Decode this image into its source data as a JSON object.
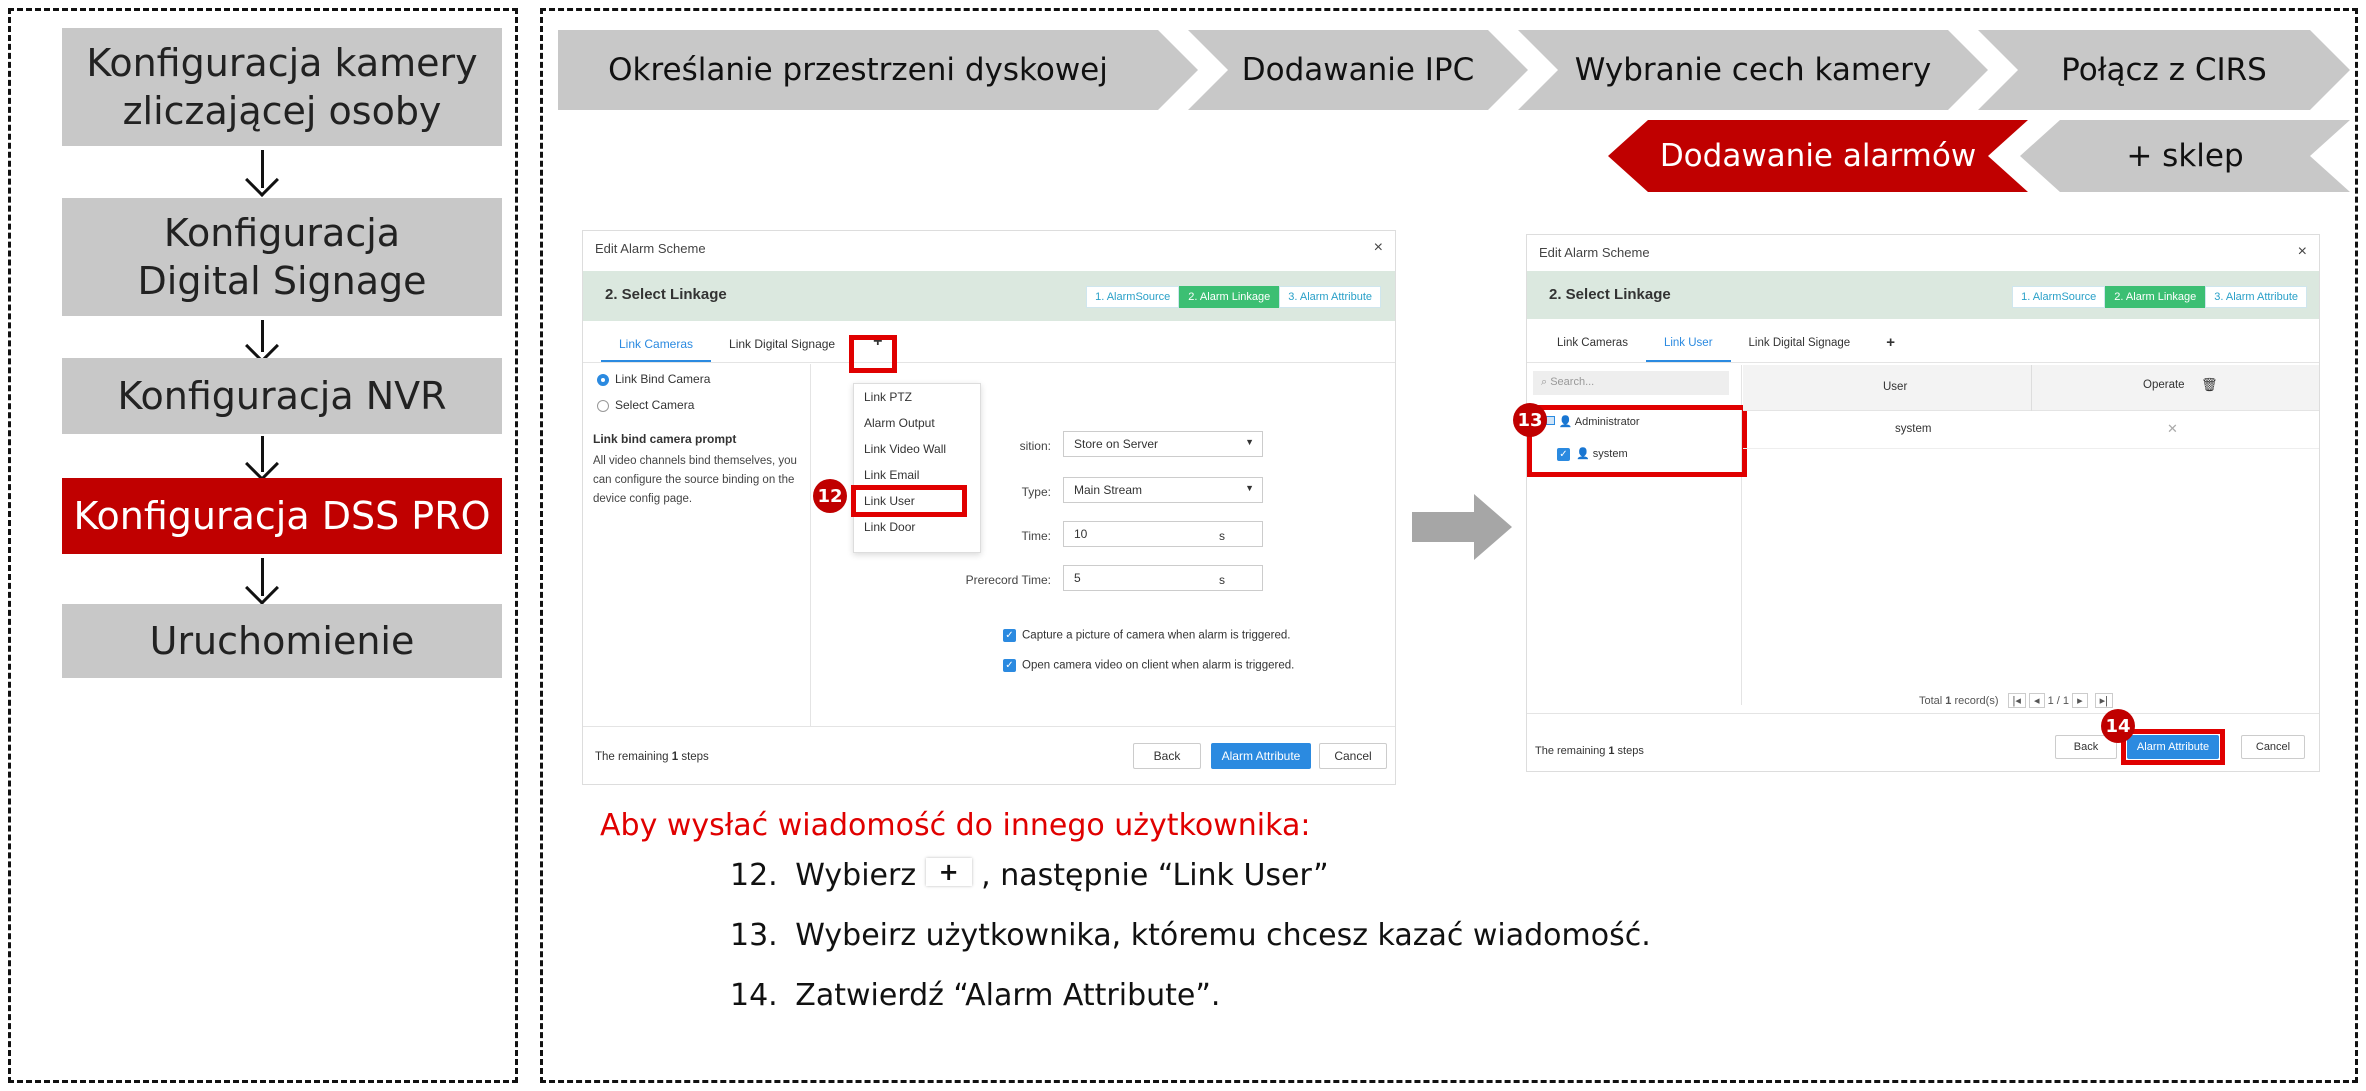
{
  "flow": {
    "items": [
      {
        "label": "Konfiguracja kamery zliczającej osoby"
      },
      {
        "label": "Konfiguracja Digital Signage"
      },
      {
        "label": "Konfiguracja NVR"
      },
      {
        "label": "Konfiguracja DSS PRO"
      },
      {
        "label": "Uruchomienie"
      }
    ]
  },
  "steps_top": [
    {
      "label": "Określanie przestrzeni dyskowej"
    },
    {
      "label": "Dodawanie IPC"
    },
    {
      "label": "Wybranie cech kamery"
    },
    {
      "label": "Połącz z CIRS"
    }
  ],
  "steps_second": [
    {
      "label": "Dodawanie alarmów"
    },
    {
      "label": "+ sklep"
    }
  ],
  "left_shot": {
    "title": "Edit Alarm Scheme",
    "close": "×",
    "step_title": "2.   Select Linkage",
    "wizard": [
      "1. AlarmSource",
      "2. Alarm Linkage",
      "3. Alarm Attribute"
    ],
    "tabs": [
      "Link Cameras",
      "Link Digital Signage",
      "+"
    ],
    "radio_bind": "Link Bind Camera",
    "radio_select": "Select Camera",
    "prompt_title": "Link bind camera prompt",
    "prompt_text": "All video channels bind themselves, you can configure the source binding on the device config page.",
    "menu": [
      "Link PTZ",
      "Alarm Output",
      "Link Video Wall",
      "Link Email",
      "Link User",
      "Link Door"
    ],
    "position_label": "sition:",
    "position_value": "Store on Server",
    "type_label": "Type:",
    "type_value": "Main Stream",
    "time_label": "Time:",
    "time_value": "10",
    "time_unit": "s",
    "prerecord_label": "Prerecord Time:",
    "prerecord_value": "5",
    "prerecord_unit": "s",
    "capture": "Capture a picture of camera when alarm is triggered.",
    "open_video": "Open camera video on client when alarm is triggered.",
    "remaining_pre": "The remaining ",
    "remaining_num": "1",
    "remaining_post": " steps",
    "back": "Back",
    "alarm_attribute": "Alarm Attribute",
    "cancel": "Cancel",
    "badge": "12"
  },
  "right_shot": {
    "title": "Edit Alarm Scheme",
    "close": "×",
    "step_title": "2.   Select Linkage",
    "wizard": [
      "1. AlarmSource",
      "2. Alarm Linkage",
      "3. Alarm Attribute"
    ],
    "tabs": [
      "Link Cameras",
      "Link User",
      "Link Digital Signage",
      "+"
    ],
    "search_placeholder": "Search...",
    "col_user": "User",
    "col_operate": "Operate",
    "tree_admin": "Administrator",
    "tree_system": "system",
    "row_user": "system",
    "row_delete": "✕",
    "total_pre": "Total ",
    "total_num": "1",
    "total_post": " record(s)",
    "page": "1 / 1",
    "remaining_pre": "The remaining ",
    "remaining_num": "1",
    "remaining_post": " steps",
    "back": "Back",
    "alarm_attribute": "Alarm Attribute",
    "cancel": "Cancel",
    "badge13": "13",
    "badge14": "14"
  },
  "instructions": {
    "heading": "Aby wysłać wiadomość do innego użytkownika:",
    "step12_num": "12.",
    "step12_pre": "Wybierz",
    "step12_post": ", następnie “Link User”",
    "step13_num": "13.",
    "step13": "Wybeirz użytkownika, któremu chcesz kazać wiadomość.",
    "step14_num": "14.",
    "step14": "Zatwierdź “Alarm Attribute”."
  },
  "colors": {
    "accent_red": "#c00000",
    "box_red": "#e00000",
    "grey": "#c8c8c8",
    "blue": "#2b8ae0",
    "green": "#3cbf73"
  }
}
